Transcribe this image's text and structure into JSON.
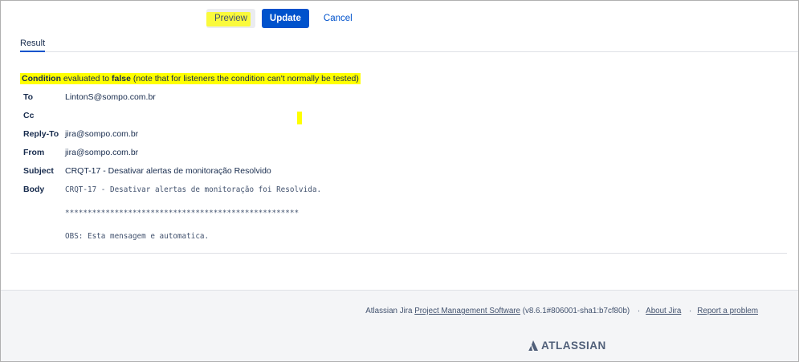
{
  "toolbar": {
    "preview_label": "Preview",
    "update_label": "Update",
    "cancel_label": "Cancel"
  },
  "tabs": [
    {
      "label": "Result"
    }
  ],
  "condition": {
    "prefix": "Condition",
    "middle": " evaluated to ",
    "value": "false",
    "note": " (note that for listeners the condition can't normally be tested)"
  },
  "email": {
    "fields": [
      {
        "label": "To",
        "value": "LintonS@sompo.com.br"
      },
      {
        "label": "Cc",
        "value": ""
      },
      {
        "label": "Reply-To",
        "value": "jira@sompo.com.br"
      },
      {
        "label": "From",
        "value": "jira@sompo.com.br"
      },
      {
        "label": "Subject",
        "value": "CRQT-17 - Desativar alertas de monitoração Resolvido"
      }
    ],
    "body_label": "Body",
    "body_lines": [
      "CRQT-17 - Desativar alertas de monitoração foi Resolvida.",
      "****************************************************",
      "OBS: Esta mensagem e automatica."
    ]
  },
  "footer": {
    "prefix": "Atlassian Jira ",
    "pms_link": "Project Management Software",
    "version": " (v8.6.1#806001-sha1:b7cf80b)",
    "separator": "·",
    "about_link": "About Jira",
    "report_link": "Report a problem",
    "logo_text": "ATLASSIAN"
  }
}
